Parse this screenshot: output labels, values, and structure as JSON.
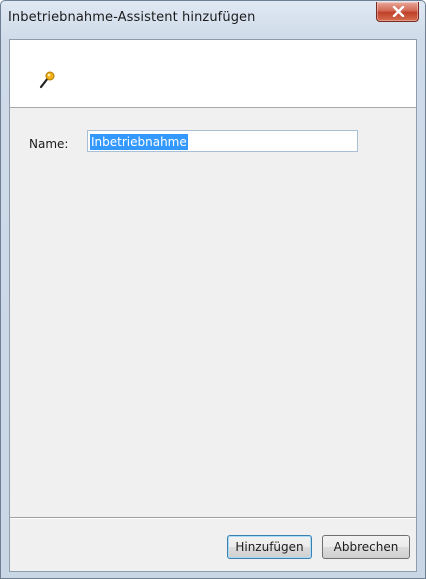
{
  "window": {
    "title": "Inbetriebnahme-Assistent hinzufügen",
    "close_icon": "close-icon"
  },
  "header": {
    "icon": "magic-wand-icon"
  },
  "form": {
    "name_label": "Name:",
    "name_value": "Inbetriebnahme"
  },
  "buttons": {
    "add_label": "Hinzufügen",
    "cancel_label": "Abbrechen"
  },
  "colors": {
    "selection": "#3399ff",
    "close_button": "#c7462e",
    "default_button_border": "#3c7fb1"
  }
}
